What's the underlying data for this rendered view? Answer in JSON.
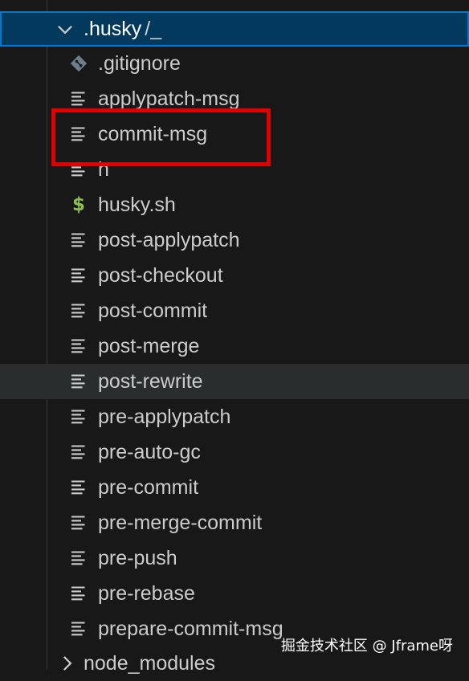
{
  "explorer": {
    "folder": {
      "name": ".husky",
      "path_suffix": "/_"
    },
    "files": [
      {
        "name": ".gitignore",
        "icon": "git-icon"
      },
      {
        "name": "applypatch-msg",
        "icon": "lines-icon"
      },
      {
        "name": "commit-msg",
        "icon": "lines-icon",
        "highlighted": true
      },
      {
        "name": "h",
        "icon": "lines-icon"
      },
      {
        "name": "husky.sh",
        "icon": "dollar-icon"
      },
      {
        "name": "post-applypatch",
        "icon": "lines-icon"
      },
      {
        "name": "post-checkout",
        "icon": "lines-icon"
      },
      {
        "name": "post-commit",
        "icon": "lines-icon"
      },
      {
        "name": "post-merge",
        "icon": "lines-icon"
      },
      {
        "name": "post-rewrite",
        "icon": "lines-icon",
        "hovered": true
      },
      {
        "name": "pre-applypatch",
        "icon": "lines-icon"
      },
      {
        "name": "pre-auto-gc",
        "icon": "lines-icon"
      },
      {
        "name": "pre-commit",
        "icon": "lines-icon"
      },
      {
        "name": "pre-merge-commit",
        "icon": "lines-icon"
      },
      {
        "name": "pre-push",
        "icon": "lines-icon"
      },
      {
        "name": "pre-rebase",
        "icon": "lines-icon"
      },
      {
        "name": "prepare-commit-msg",
        "icon": "lines-icon"
      }
    ],
    "next_folder": {
      "name": "node_modules"
    }
  },
  "watermark": "掘金技术社区 @ Jframe呀",
  "colors": {
    "background": "#181818",
    "selected_bg": "#04395e",
    "focus_border": "#0078d4",
    "hover_bg": "#2a2d2e",
    "text": "#cccccc",
    "shell_icon": "#8dc149",
    "annotation_box": "#e00000"
  }
}
